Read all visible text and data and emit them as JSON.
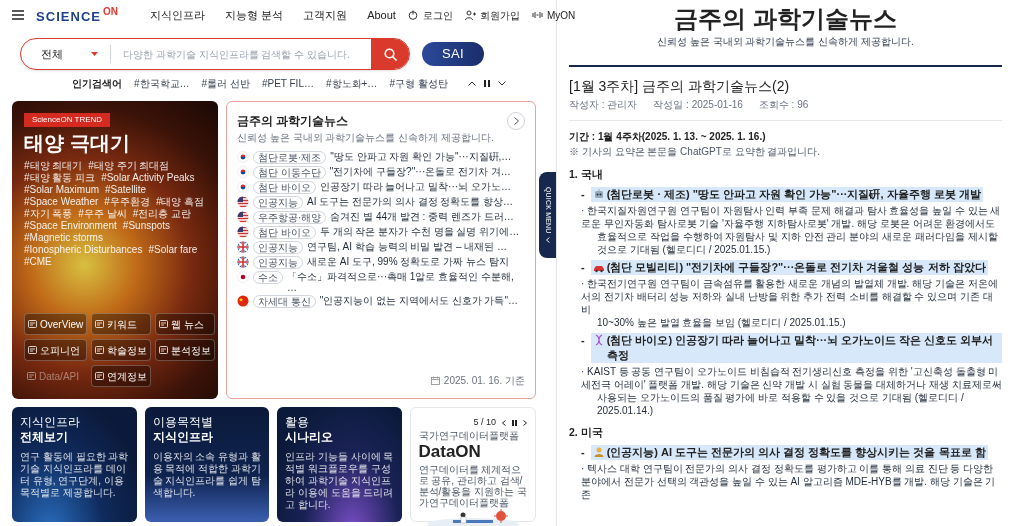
{
  "header": {
    "logo": {
      "text": "SCIENCE",
      "accent": "ON"
    },
    "menu": [
      "지식인프라",
      "지능형 분석",
      "고객지원",
      "About"
    ],
    "user_links": [
      {
        "kind": "login",
        "label": "로그인"
      },
      {
        "kind": "signup",
        "label": "회원가입"
      },
      {
        "kind": "myon",
        "label": "MyON"
      }
    ]
  },
  "search": {
    "scope": "전체",
    "placeholder": "다양한 과학기술 지식인프라를 검색할 수 있습니다.",
    "sai_button": "SAI"
  },
  "popular": {
    "label": "인기검색어",
    "terms": [
      "#한국학교…",
      "#롤러 선반",
      "#PET FIL…",
      "#항노화+…",
      "#구형 활성탄"
    ]
  },
  "trend": {
    "badge": "ScienceON TREND",
    "title": "태양 극대기",
    "tags": [
      "#태양 최대기",
      "#태양 주기 최대점",
      "#태양 활동 피크",
      "#Solar Activity Peaks",
      "#Solar Maximum",
      "#Satellite",
      "#Space Weather",
      "#우주환경",
      "#태양 흑점",
      "#자기 폭풍",
      "#우주 날씨",
      "#전리층 교란",
      "#Space Environment",
      "#Sunspots",
      "#Magnetic storms",
      "#Ionospheric Disturbances",
      "#Solar fare",
      "#CME"
    ],
    "buttons": [
      {
        "label": "OverView",
        "disabled": false
      },
      {
        "label": "키워드",
        "disabled": false
      },
      {
        "label": "웹 뉴스",
        "disabled": false
      },
      {
        "label": "오피니언",
        "disabled": false
      },
      {
        "label": "학술정보",
        "disabled": false
      },
      {
        "label": "분석정보",
        "disabled": false
      },
      {
        "label": "Data/API",
        "disabled": true
      },
      {
        "label": "연계정보",
        "disabled": false
      }
    ]
  },
  "news_card": {
    "title": "금주의 과학기술뉴스",
    "subtitle": "신뢰성 높은 국내외 과학기술뉴스를 신속하게 제공합니다.",
    "items": [
      {
        "kind": "korea",
        "category": "첨단로봇·제조",
        "headline": "\"땅도 안파고 자원 확인 가능\"···지질硏,…"
      },
      {
        "kind": "korea",
        "category": "첨단 이동수단",
        "headline": "\"전기차에 구들장?\"···온돌로 전기차 겨…"
      },
      {
        "kind": "korea",
        "category": "첨단 바이오",
        "headline": "인공장기 따라 늘어나고 밀착···뇌 오가노…"
      },
      {
        "kind": "usa",
        "category": "인공지능",
        "headline": "AI 도구는 전문가의 의사 결정 정확도를 향상…"
      },
      {
        "kind": "usa",
        "category": "우주항공·해양",
        "headline": "숨겨진 별 44개 발견 : 중력 렌즈가 드러…"
      },
      {
        "kind": "usa",
        "category": "첨단 바이오",
        "headline": "두 개의 작은 분자가 수천 명을 실명 위기에…"
      },
      {
        "kind": "uk",
        "category": "인공지능",
        "headline": "연구팀, AI 학습 능력의 비밀 발견 – 내재된 …"
      },
      {
        "kind": "uk",
        "category": "인공지능",
        "headline": "새로운 AI 도구, 99% 정확도로 가짜 뉴스 탐지"
      },
      {
        "kind": "japan",
        "category": "수소",
        "headline": "「수소」파격적으로···촉매 1알로 효율적인 수분해, …"
      },
      {
        "kind": "china",
        "category": "차세대 통신",
        "headline": "\"인공지능이 없는 지역에서도 신호가 가득\"…"
      }
    ],
    "date": "2025. 01. 16. 기준"
  },
  "quick_menu": {
    "label": "QUICK MENU"
  },
  "feature_cards": [
    {
      "kind": "info",
      "title_light": "지식인프라",
      "title_bold": "전체보기",
      "text": "연구 활동에 필요한 과학기술 지식인프라를 데이터 유형, 연구단계, 이용목적별로 제공합니다."
    },
    {
      "kind": "info",
      "title_light": "이용목적별",
      "title_bold": "지식인프라",
      "text": "이용자의 소속 유형과 활용 목적에 적합한 과학기술 지식인프라를 쉽게 탐색합니다."
    },
    {
      "kind": "info",
      "title_light": "활용",
      "title_bold": "시나리오",
      "text": "인프라 기능들 사이에 목적별 워크플로우를 구성하여 과학기술 지식인프라 이용에 도움을 드리려고 합니다."
    },
    {
      "kind": "promo",
      "counter": "5 / 10",
      "eyebrow": "국가연구데이터플랫폼",
      "title": "DataON",
      "text": "연구데이터를 체계적으로 공유, 관리하고 검색/분석/활용을 지원하는 국가연구데이터플랫폼"
    }
  ],
  "article": {
    "page_title": "금주의 과학기술뉴스",
    "page_subtitle": "신뢰성 높은 국내외 과학기술뉴스를 신속하게 제공합니다.",
    "title": "[1월 3주차] 금주의 과학기술뉴스(2)",
    "meta": [
      "작성자 : 관리자",
      "작성일 : 2025-01-16",
      "조회수 : 96"
    ],
    "period": "기간 : 1월 4주차(2025. 1. 13. ~ 2025. 1. 16.)",
    "note": "※ 기사의 요약은 본문을 ChatGPT로 요약한 결과입니다.",
    "sections": [
      {
        "heading": "1. 국내",
        "items": [
          {
            "marker": "-",
            "headline": "(첨단로봇 · 제조) \"땅도 안파고 자원 확인 가능\"···지질硏, 자율주행 로봇 개발",
            "lines": [
              "· 한국지질자원연구원 연구팀이 자원탐사 인력 부족 문제 해결과 탐사 효율성을 높일 수 있는 새로운 무인자동화 탐사로봇 기술 '자율주행 지하탐사로봇' 개발. 해당 로봇은 어려운 환경에서도",
              "효율적으로 작업을 수행하여 자원탐사 및 지하 안전 관리 분야의 새로운 패러다임을 제시할 것으로 기대됨 (헬로디디 / 2025.01.15.)"
            ]
          },
          {
            "marker": "-",
            "headline": "(첨단 모빌리티) \"전기차에 구들장?\"···온돌로 전기차 겨울철 성능 저하 잡았다",
            "lines": [
              "· 한국전기연구원 연구팀이 금속섬유를 활용한 새로운 개념의 발열체 개발. 해당 기술은 저온에서의 전기차 배터리 성능 저하와 실내 난방을 위한 추가 전력 소비를 해결할 수 있으며 기존 대비",
              "10~30% 높은 발열 효율을 보임 (헬로디디 / 2025.01.15.)"
            ]
          },
          {
            "marker": "-",
            "headline": "(첨단 바이오) 인공장기 따라 늘어나고 밀착···뇌 오가노이드 작은 신호도 외부서 측정",
            "lines": [
              "· KAIST 등 공동 연구팀이 오가노이드 비침습적 전기생리신호 측정을 위한 '고신축성 돌출형 미세전극 어레이' 플랫폼 개발. 해당 기술은 신약 개발 시 실험 동물을 대체하거나 재생 치료제로써",
              "사용되는 오가노이드의 품질 평가에 바로 적용할 수 있을 것으로 기대됨 (헬로디디 / 2025.01.14.)"
            ]
          }
        ]
      },
      {
        "heading": "2. 미국",
        "items": [
          {
            "marker": "-",
            "headline": "(인공지능) AI 도구는 전문가의 의사 결정 정확도를 향상시키는 것을 목표로 함",
            "lines": [
              "· 텍사스 대학 연구팀이 전문가의 의사 결정 정확도를 평가하고 이를 통해 의료 진단 등 다양한 분야에서 전문가 선택의 객관성을 높일 수 있는 AI 알고리즘 MDE-HYB를 개발. 해당 기술은 기존"
            ]
          }
        ]
      }
    ]
  }
}
